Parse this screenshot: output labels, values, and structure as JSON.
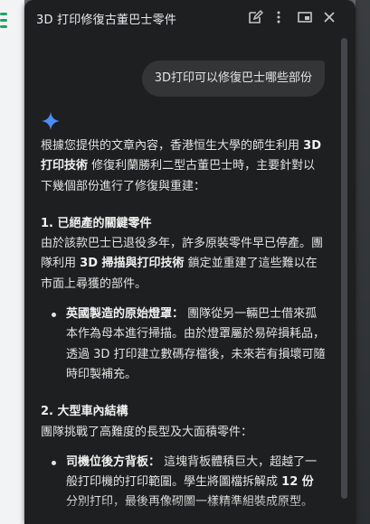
{
  "window": {
    "title": "3D 打印修復古董巴士零件"
  },
  "user_message": "3D打印可以修復巴士哪些部份",
  "response": {
    "intro_pre": "根據您提供的文章內容，香港恒生大學的師生利用",
    "intro_bold": "3D 打印技術",
    "intro_post": "修復利蘭勝利二型古董巴士時，主要針對以下幾個部份進行了修復與重建：",
    "section1": {
      "heading": "1. 已絕產的關鍵零件",
      "para_pre": "由於該款巴士已退役多年，許多原裝零件早已停產。團隊利用",
      "para_bold": "3D 掃描與打印技術",
      "para_post": "鎖定並重建了這些難以在市面上尋獲的部件。",
      "bullet_bold": "英國製造的原始燈罩：",
      "bullet_text": "團隊從另一輛巴士借來孤本作為母本進行掃描。由於燈罩屬於易碎損耗品，透過 3D 打印建立數碼存檔後，未來若有損壞可隨時印製補充。"
    },
    "section2": {
      "heading": "2. 大型車內結構",
      "para": "團隊挑戰了高難度的長型及大面積零件：",
      "bullet_bold": "司機位後方背板：",
      "bullet_text_pre": "這塊背板體積巨大，超越了一般打印機的打印範圍。學生將圖檔拆解成",
      "bullet_bold2": "12 份",
      "bullet_text_post": "分別打印，最後再像砌圖一樣精準組裝成原型。"
    }
  },
  "icons": {
    "edit": "edit-icon",
    "more": "more-vert-icon",
    "window": "picture-in-picture-icon",
    "close": "close-icon",
    "sparkle": "gemini-sparkle-icon"
  },
  "colors": {
    "panel_bg": "#1e1f20",
    "bubble_bg": "#333537",
    "text": "#e3e3e3",
    "sparkle_blue": "#4c8df6"
  }
}
